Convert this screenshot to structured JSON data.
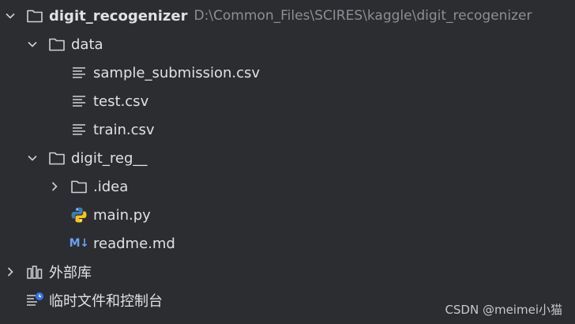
{
  "tree": {
    "root": {
      "name": "digit_recogenizer",
      "path": "D:\\Common_Files\\SCIRES\\kaggle\\digit_recogenizer"
    },
    "data_folder": {
      "name": "data"
    },
    "data_files": [
      "sample_submission.csv",
      "test.csv",
      "train.csv"
    ],
    "reg_folder": {
      "name": "digit_reg__"
    },
    "idea_folder": {
      "name": ".idea"
    },
    "main_file": {
      "name": "main.py"
    },
    "readme_file": {
      "name": "readme.md",
      "icon_text": "M↓"
    },
    "external_libs": {
      "name": "外部库"
    },
    "scratches": {
      "name": "临时文件和控制台"
    }
  },
  "watermark": "CSDN @meimei小猫",
  "colors": {
    "background": "#2b2d30",
    "text": "#dfe1e5",
    "muted": "#8c8f94",
    "md_blue": "#6b9df7"
  }
}
